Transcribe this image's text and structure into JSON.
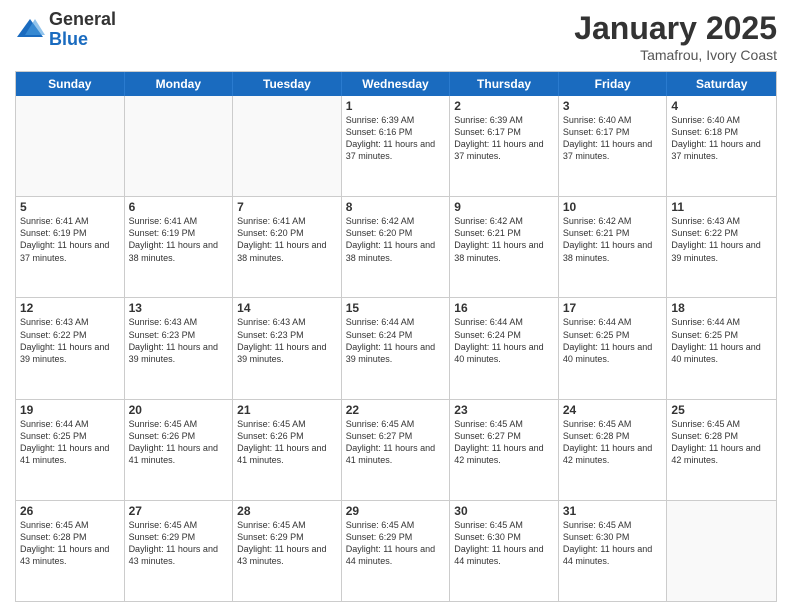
{
  "logo": {
    "general": "General",
    "blue": "Blue"
  },
  "title": "January 2025",
  "subtitle": "Tamafrou, Ivory Coast",
  "days": [
    "Sunday",
    "Monday",
    "Tuesday",
    "Wednesday",
    "Thursday",
    "Friday",
    "Saturday"
  ],
  "rows": [
    [
      {
        "num": "",
        "text": ""
      },
      {
        "num": "",
        "text": ""
      },
      {
        "num": "",
        "text": ""
      },
      {
        "num": "1",
        "text": "Sunrise: 6:39 AM\nSunset: 6:16 PM\nDaylight: 11 hours and 37 minutes."
      },
      {
        "num": "2",
        "text": "Sunrise: 6:39 AM\nSunset: 6:17 PM\nDaylight: 11 hours and 37 minutes."
      },
      {
        "num": "3",
        "text": "Sunrise: 6:40 AM\nSunset: 6:17 PM\nDaylight: 11 hours and 37 minutes."
      },
      {
        "num": "4",
        "text": "Sunrise: 6:40 AM\nSunset: 6:18 PM\nDaylight: 11 hours and 37 minutes."
      }
    ],
    [
      {
        "num": "5",
        "text": "Sunrise: 6:41 AM\nSunset: 6:19 PM\nDaylight: 11 hours and 37 minutes."
      },
      {
        "num": "6",
        "text": "Sunrise: 6:41 AM\nSunset: 6:19 PM\nDaylight: 11 hours and 38 minutes."
      },
      {
        "num": "7",
        "text": "Sunrise: 6:41 AM\nSunset: 6:20 PM\nDaylight: 11 hours and 38 minutes."
      },
      {
        "num": "8",
        "text": "Sunrise: 6:42 AM\nSunset: 6:20 PM\nDaylight: 11 hours and 38 minutes."
      },
      {
        "num": "9",
        "text": "Sunrise: 6:42 AM\nSunset: 6:21 PM\nDaylight: 11 hours and 38 minutes."
      },
      {
        "num": "10",
        "text": "Sunrise: 6:42 AM\nSunset: 6:21 PM\nDaylight: 11 hours and 38 minutes."
      },
      {
        "num": "11",
        "text": "Sunrise: 6:43 AM\nSunset: 6:22 PM\nDaylight: 11 hours and 39 minutes."
      }
    ],
    [
      {
        "num": "12",
        "text": "Sunrise: 6:43 AM\nSunset: 6:22 PM\nDaylight: 11 hours and 39 minutes."
      },
      {
        "num": "13",
        "text": "Sunrise: 6:43 AM\nSunset: 6:23 PM\nDaylight: 11 hours and 39 minutes."
      },
      {
        "num": "14",
        "text": "Sunrise: 6:43 AM\nSunset: 6:23 PM\nDaylight: 11 hours and 39 minutes."
      },
      {
        "num": "15",
        "text": "Sunrise: 6:44 AM\nSunset: 6:24 PM\nDaylight: 11 hours and 39 minutes."
      },
      {
        "num": "16",
        "text": "Sunrise: 6:44 AM\nSunset: 6:24 PM\nDaylight: 11 hours and 40 minutes."
      },
      {
        "num": "17",
        "text": "Sunrise: 6:44 AM\nSunset: 6:25 PM\nDaylight: 11 hours and 40 minutes."
      },
      {
        "num": "18",
        "text": "Sunrise: 6:44 AM\nSunset: 6:25 PM\nDaylight: 11 hours and 40 minutes."
      }
    ],
    [
      {
        "num": "19",
        "text": "Sunrise: 6:44 AM\nSunset: 6:25 PM\nDaylight: 11 hours and 41 minutes."
      },
      {
        "num": "20",
        "text": "Sunrise: 6:45 AM\nSunset: 6:26 PM\nDaylight: 11 hours and 41 minutes."
      },
      {
        "num": "21",
        "text": "Sunrise: 6:45 AM\nSunset: 6:26 PM\nDaylight: 11 hours and 41 minutes."
      },
      {
        "num": "22",
        "text": "Sunrise: 6:45 AM\nSunset: 6:27 PM\nDaylight: 11 hours and 41 minutes."
      },
      {
        "num": "23",
        "text": "Sunrise: 6:45 AM\nSunset: 6:27 PM\nDaylight: 11 hours and 42 minutes."
      },
      {
        "num": "24",
        "text": "Sunrise: 6:45 AM\nSunset: 6:28 PM\nDaylight: 11 hours and 42 minutes."
      },
      {
        "num": "25",
        "text": "Sunrise: 6:45 AM\nSunset: 6:28 PM\nDaylight: 11 hours and 42 minutes."
      }
    ],
    [
      {
        "num": "26",
        "text": "Sunrise: 6:45 AM\nSunset: 6:28 PM\nDaylight: 11 hours and 43 minutes."
      },
      {
        "num": "27",
        "text": "Sunrise: 6:45 AM\nSunset: 6:29 PM\nDaylight: 11 hours and 43 minutes."
      },
      {
        "num": "28",
        "text": "Sunrise: 6:45 AM\nSunset: 6:29 PM\nDaylight: 11 hours and 43 minutes."
      },
      {
        "num": "29",
        "text": "Sunrise: 6:45 AM\nSunset: 6:29 PM\nDaylight: 11 hours and 44 minutes."
      },
      {
        "num": "30",
        "text": "Sunrise: 6:45 AM\nSunset: 6:30 PM\nDaylight: 11 hours and 44 minutes."
      },
      {
        "num": "31",
        "text": "Sunrise: 6:45 AM\nSunset: 6:30 PM\nDaylight: 11 hours and 44 minutes."
      },
      {
        "num": "",
        "text": ""
      }
    ]
  ]
}
